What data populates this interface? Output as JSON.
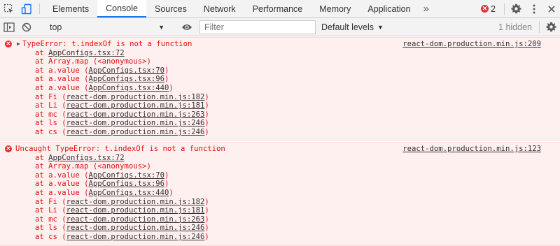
{
  "tabs": [
    {
      "label": "Elements",
      "active": false
    },
    {
      "label": "Console",
      "active": true
    },
    {
      "label": "Sources",
      "active": false
    },
    {
      "label": "Network",
      "active": false
    },
    {
      "label": "Performance",
      "active": false
    },
    {
      "label": "Memory",
      "active": false
    },
    {
      "label": "Application",
      "active": false
    }
  ],
  "more_tabs_glyph": "»",
  "error_badge": {
    "count": "2",
    "icon": "error-circle-icon",
    "color": "#e0322f"
  },
  "toolbar": {
    "context": "top",
    "filter_placeholder": "Filter",
    "levels": "Default levels",
    "hidden": "1 hidden"
  },
  "accent_color": "#1a73e8",
  "messages": [
    {
      "text": "TypeError: t.indexOf is not a function",
      "source": "react-dom.production.min.js:209",
      "expandable": true,
      "frames": [
        {
          "fn": "at ",
          "loc": "AppConfigs.tsx:72",
          "paren": false
        },
        {
          "fn": "at Array.map (<anonymous>)",
          "loc": "",
          "paren": false
        },
        {
          "fn": "at a.value (",
          "loc": "AppConfigs.tsx:70",
          "paren": true
        },
        {
          "fn": "at a.value (",
          "loc": "AppConfigs.tsx:96",
          "paren": true
        },
        {
          "fn": "at a.value (",
          "loc": "AppConfigs.tsx:440",
          "paren": true
        },
        {
          "fn": "at Fi (",
          "loc": "react-dom.production.min.js:182",
          "paren": true
        },
        {
          "fn": "at Li (",
          "loc": "react-dom.production.min.js:181",
          "paren": true
        },
        {
          "fn": "at mc (",
          "loc": "react-dom.production.min.js:263",
          "paren": true
        },
        {
          "fn": "at ls (",
          "loc": "react-dom.production.min.js:246",
          "paren": true
        },
        {
          "fn": "at cs (",
          "loc": "react-dom.production.min.js:246",
          "paren": true
        }
      ]
    },
    {
      "text": "Uncaught TypeError: t.indexOf is not a function",
      "source": "react-dom.production.min.js:123",
      "expandable": false,
      "frames": [
        {
          "fn": "at ",
          "loc": "AppConfigs.tsx:72",
          "paren": false
        },
        {
          "fn": "at Array.map (<anonymous>)",
          "loc": "",
          "paren": false
        },
        {
          "fn": "at a.value (",
          "loc": "AppConfigs.tsx:70",
          "paren": true
        },
        {
          "fn": "at a.value (",
          "loc": "AppConfigs.tsx:96",
          "paren": true
        },
        {
          "fn": "at a.value (",
          "loc": "AppConfigs.tsx:440",
          "paren": true
        },
        {
          "fn": "at Fi (",
          "loc": "react-dom.production.min.js:182",
          "paren": true
        },
        {
          "fn": "at Li (",
          "loc": "react-dom.production.min.js:181",
          "paren": true
        },
        {
          "fn": "at mc (",
          "loc": "react-dom.production.min.js:263",
          "paren": true
        },
        {
          "fn": "at ls (",
          "loc": "react-dom.production.min.js:246",
          "paren": true
        },
        {
          "fn": "at cs (",
          "loc": "react-dom.production.min.js:246",
          "paren": true
        }
      ]
    }
  ]
}
